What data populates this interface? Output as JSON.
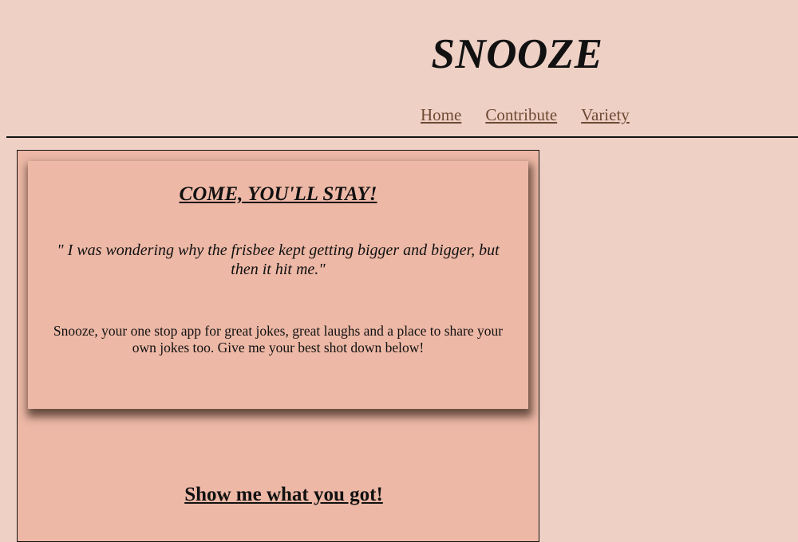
{
  "header": {
    "title": "SNOOZE",
    "nav": [
      {
        "label": "Home"
      },
      {
        "label": "Contribute"
      },
      {
        "label": "Variety"
      }
    ]
  },
  "hero": {
    "title": "COME, YOU'LL STAY!",
    "quote": "\" I was wondering why the frisbee kept getting bigger and bigger, but then it hit me.\"",
    "blurb": "Snooze, your one stop app for great jokes, great laughs and a place to share your own jokes too. Give me your best shot down below!"
  },
  "section": {
    "title": "Show me what you got!"
  },
  "colors": {
    "page_background": "#efd0c5",
    "panel_background": "#edb8a6",
    "link": "#6d4a34",
    "text": "#111111"
  }
}
